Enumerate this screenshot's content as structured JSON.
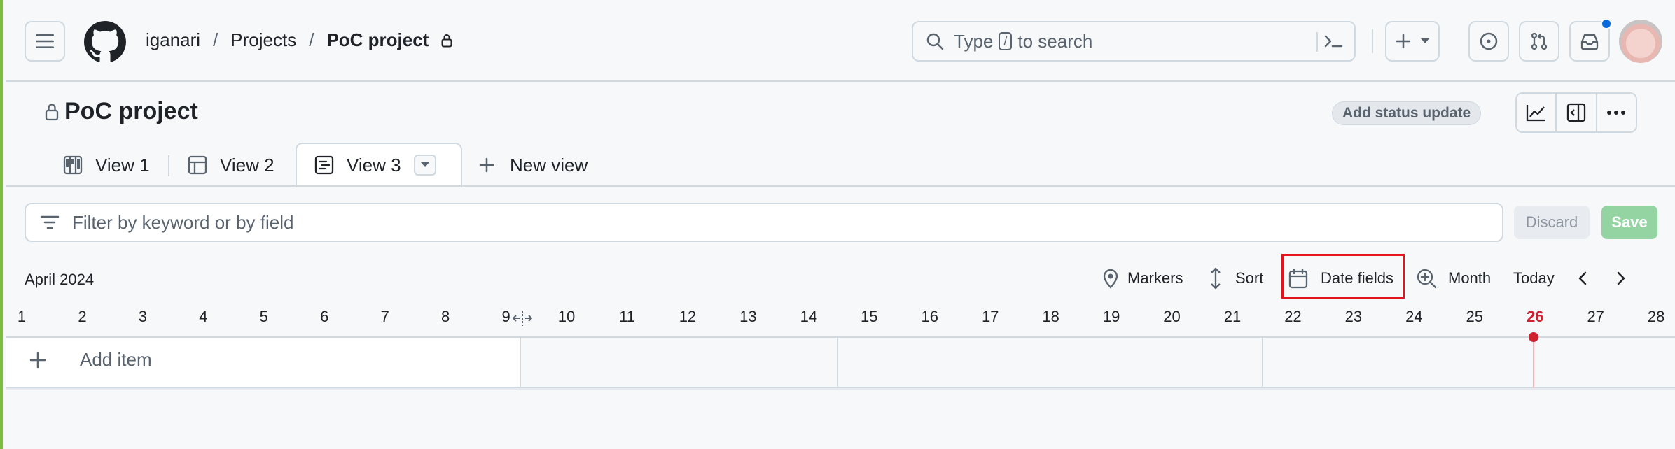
{
  "breadcrumb": {
    "owner": "iganari",
    "separator": "/",
    "section": "Projects",
    "project": "PoC project"
  },
  "search": {
    "prefix": "Type",
    "key": "/",
    "suffix": "to search"
  },
  "project": {
    "title": "PoC project",
    "status_update_label": "Add status update"
  },
  "tabs": [
    {
      "label": "View 1",
      "icon": "board-icon"
    },
    {
      "label": "View 2",
      "icon": "table-icon"
    },
    {
      "label": "View 3",
      "icon": "roadmap-icon",
      "active": true
    }
  ],
  "new_view_label": "New view",
  "filter": {
    "placeholder": "Filter by keyword or by field",
    "discard_label": "Discard",
    "save_label": "Save"
  },
  "roadmap": {
    "month_label": "April 2024",
    "toolbar": {
      "markers": "Markers",
      "sort": "Sort",
      "date_fields": "Date fields",
      "zoom": "Month",
      "today": "Today"
    },
    "days": [
      1,
      2,
      3,
      4,
      5,
      6,
      7,
      8,
      9,
      10,
      11,
      12,
      13,
      14,
      15,
      16,
      17,
      18,
      19,
      20,
      21,
      22,
      23,
      24,
      25,
      26,
      27,
      28
    ],
    "today_day": 26,
    "add_item_label": "Add item"
  },
  "colors": {
    "accent_today": "#cf222e",
    "highlight_box": "#e5131c",
    "save_button": "#94d3a2",
    "notification_dot": "#0969da"
  }
}
